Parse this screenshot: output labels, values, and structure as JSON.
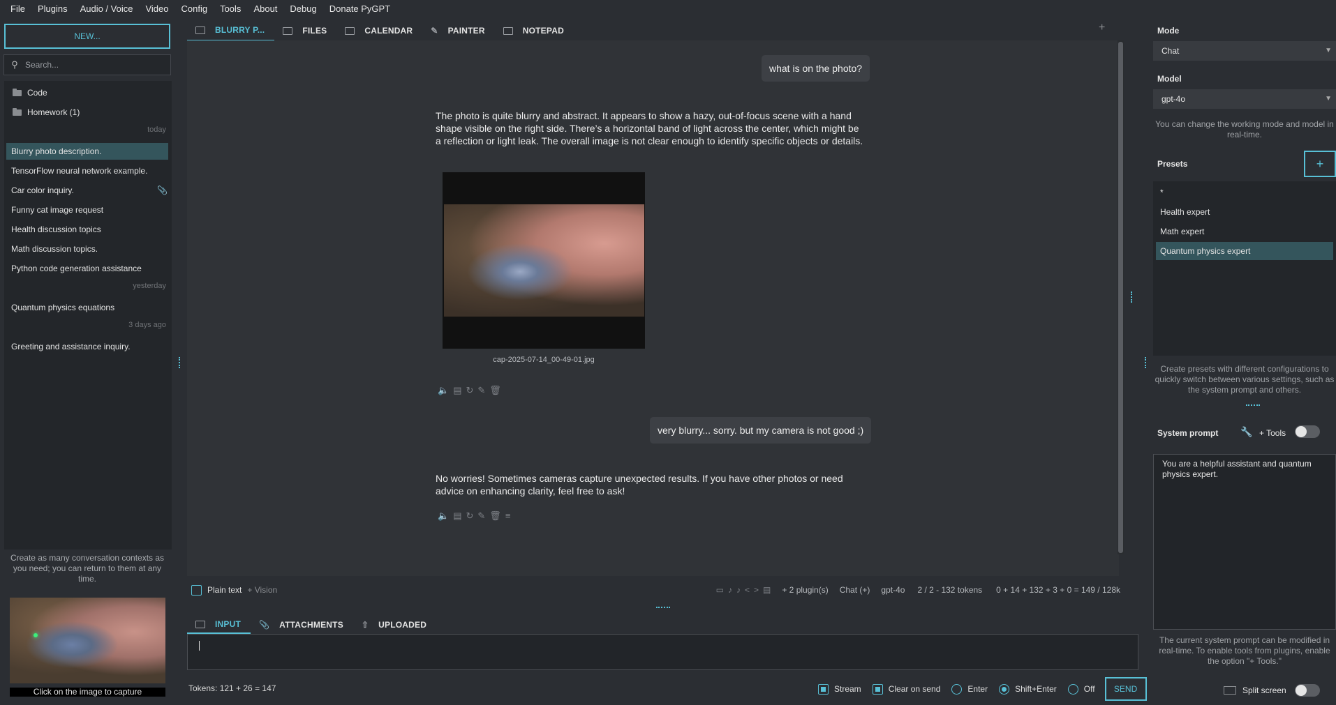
{
  "menubar": [
    "File",
    "Plugins",
    "Audio / Voice",
    "Video",
    "Config",
    "Tools",
    "About",
    "Debug",
    "Donate PyGPT"
  ],
  "left": {
    "new_label": "NEW...",
    "search_placeholder": "Search...",
    "folders": [
      "Code",
      "Homework (1)"
    ],
    "groups": {
      "today": "today",
      "yesterday": "yesterday",
      "older": "3 days ago"
    },
    "today_items": [
      "Blurry photo description.",
      "TensorFlow neural network example.",
      "Car color inquiry.",
      "Funny cat image request",
      "Health discussion topics",
      "Math discussion topics.",
      "Python code generation assistance"
    ],
    "yesterday_items": [
      "Quantum physics equations"
    ],
    "older_items": [
      "Greeting and assistance inquiry."
    ],
    "selected_item": "Blurry photo description.",
    "hint": "Create as many conversation contexts as you need; you can return to them at any time.",
    "camera_caption": "Click on the image to capture"
  },
  "tabs": [
    "BLURRY P...",
    "FILES",
    "CALENDAR",
    "PAINTER",
    "NOTEPAD"
  ],
  "chat": {
    "msg1_user": "what is on the photo?",
    "msg1_ai": "The photo is quite blurry and abstract. It appears to show a hazy, out-of-focus scene with a hand shape visible on the right side. There’s a horizontal band of light across the center, which might be a reflection or light leak. The overall image is not clear enough to identify specific objects or details.",
    "image_caption": "cap-2025-07-14_00-49-01.jpg",
    "msg2_user": "very blurry... sorry. but my camera is not good ;)",
    "msg2_ai": "No worries! Sometimes cameras capture unexpected results. If you have other photos or need advice on enhancing clarity, feel free to ask!"
  },
  "status": {
    "plain_text": "Plain text",
    "vision": "+ Vision",
    "plugins": "+ 2 plugin(s)",
    "mode": "Chat (+)",
    "model": "gpt-4o",
    "ctx_tokens": "2 / 2 - 132 tokens",
    "sum_tokens": "0 + 14 + 132 + 3 + 0 = 149 / 128k"
  },
  "input_tabs": [
    "INPUT",
    "ATTACHMENTS",
    "UPLOADED"
  ],
  "input": {
    "tokens": "Tokens: 121 + 26 = 147",
    "stream": "Stream",
    "clear_on_send": "Clear on send",
    "enter": "Enter",
    "shift_enter": "Shift+Enter",
    "off": "Off",
    "send": "SEND"
  },
  "right": {
    "mode_label": "Mode",
    "mode_value": "Chat",
    "model_label": "Model",
    "model_value": "gpt-4o",
    "mode_hint": "You can change the working mode and model in real-time.",
    "presets_label": "Presets",
    "presets": [
      "*",
      "Health expert",
      "Math expert",
      "Quantum physics expert"
    ],
    "preset_hint": "Create presets with different configurations to quickly switch between various settings, such as the system prompt and others.",
    "sysprompt_label": "System prompt",
    "tools_label": "+ Tools",
    "sysprompt": "You are a helpful assistant and quantum physics expert.",
    "sysprompt_hint": "The current system prompt can be modified in real-time. To enable tools from plugins, enable the option \"+ Tools.\"",
    "split_screen": "Split screen"
  },
  "colors": {
    "accent": "#58c0d6",
    "selected": "#34555c",
    "bg": "#2b2e33",
    "chat_bg": "#303337"
  }
}
